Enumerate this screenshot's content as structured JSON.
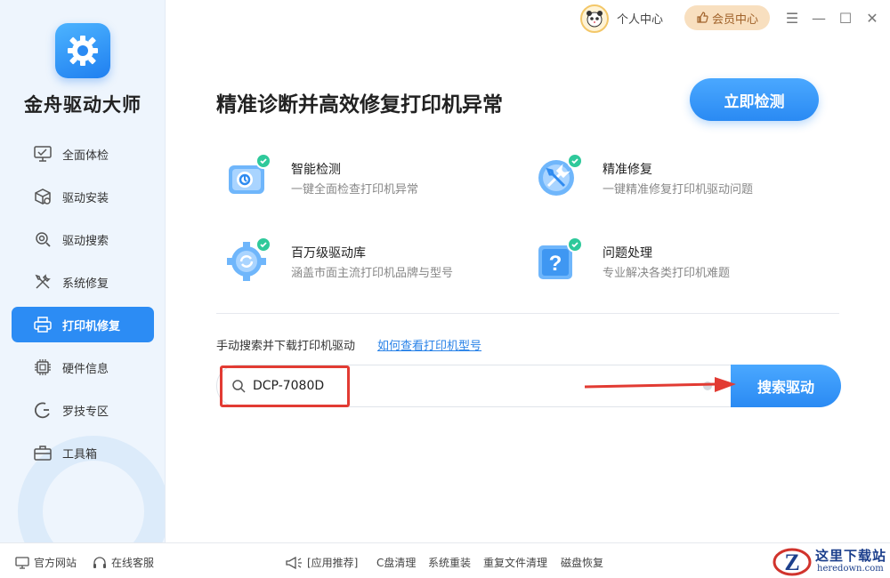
{
  "app": {
    "name": "金舟驱动大师"
  },
  "sidebar": {
    "items": [
      {
        "label": "全面体检",
        "icon": "monitor-check-icon",
        "active": false
      },
      {
        "label": "驱动安装",
        "icon": "box-gear-icon",
        "active": false
      },
      {
        "label": "驱动搜索",
        "icon": "gear-search-icon",
        "active": false
      },
      {
        "label": "系统修复",
        "icon": "wrench-screwdriver-icon",
        "active": false
      },
      {
        "label": "打印机修复",
        "icon": "printer-icon",
        "active": true
      },
      {
        "label": "硬件信息",
        "icon": "chip-icon",
        "active": false
      },
      {
        "label": "罗技专区",
        "icon": "logitech-icon",
        "active": false
      },
      {
        "label": "工具箱",
        "icon": "toolbox-icon",
        "active": false
      }
    ]
  },
  "topbar": {
    "profile_label": "个人中心",
    "vip_label": "会员中心",
    "menu_glyph": "☰",
    "minimize_glyph": "—",
    "maximize_glyph": "☐",
    "close_glyph": "✕"
  },
  "main": {
    "title": "精准诊断并高效修复打印机异常",
    "detect_button": "立即检测",
    "features": [
      {
        "title": "智能检测",
        "desc": "一键全面检查打印机异常",
        "icon": "camera-detect-icon"
      },
      {
        "title": "精准修复",
        "desc": "一键精准修复打印机驱动问题",
        "icon": "wrench-repair-icon"
      },
      {
        "title": "百万级驱动库",
        "desc": "涵盖市面主流打印机品牌与型号",
        "icon": "gear-refresh-icon"
      },
      {
        "title": "问题处理",
        "desc": "专业解决各类打印机难题",
        "icon": "question-icon"
      }
    ],
    "manual_search_label": "手动搜索并下载打印机驱动",
    "help_link": "如何查看打印机型号",
    "search": {
      "value": "DCP-7080D",
      "button": "搜索驱动"
    }
  },
  "footer": {
    "left": [
      {
        "label": "官方网站",
        "icon": "monitor-icon"
      },
      {
        "label": "在线客服",
        "icon": "headset-icon"
      }
    ],
    "recommend_label": "[应用推荐]",
    "links": [
      "C盘清理",
      "系统重装",
      "重复文件清理",
      "磁盘恢复"
    ]
  },
  "watermark": {
    "title": "这里下载站",
    "domain": "heredown.com"
  },
  "colors": {
    "accent": "#2c8cf4",
    "success": "#2fc99b",
    "annotation": "#e23b33",
    "vip": "#f8dfbf"
  }
}
